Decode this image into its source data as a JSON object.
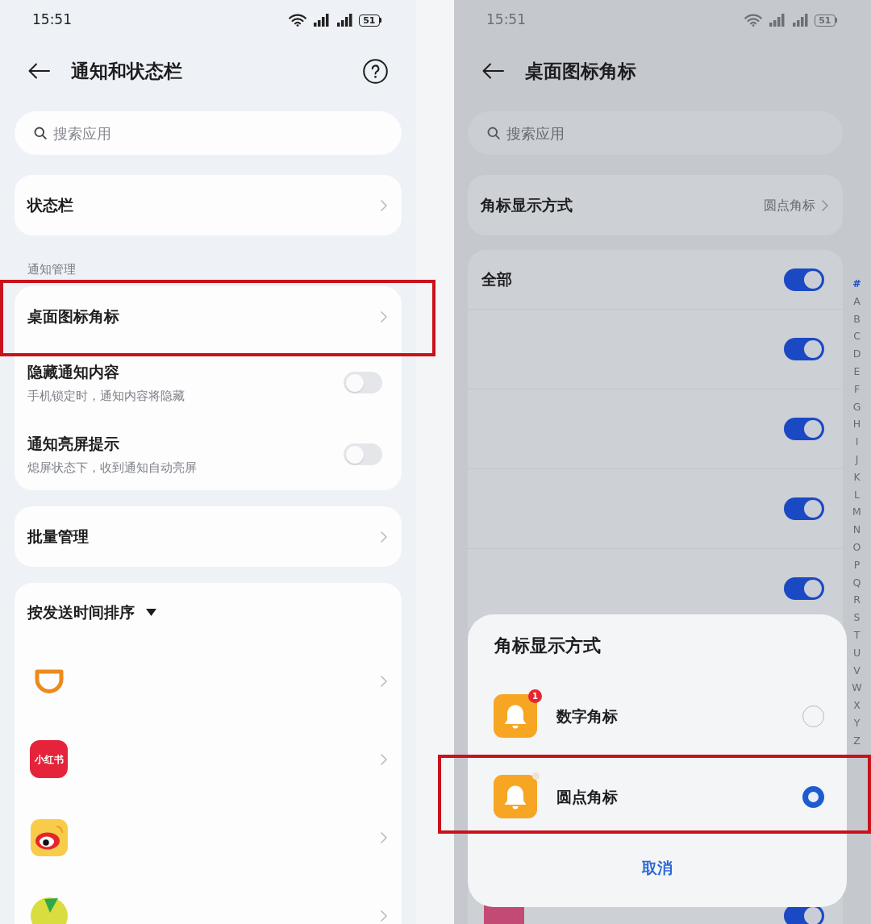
{
  "left_screen": {
    "status_bar": {
      "time": "15:51",
      "battery": "51"
    },
    "header": {
      "title": "通知和状态栏"
    },
    "search": {
      "placeholder": "搜索应用"
    },
    "groups": [
      {
        "items": [
          {
            "kind": "link",
            "label": "状态栏",
            "highlighted": false
          }
        ]
      },
      {
        "section_label": "通知管理",
        "items": [
          {
            "kind": "link",
            "label": "桌面图标角标",
            "highlighted": true
          },
          {
            "kind": "switch",
            "label": "隐藏通知内容",
            "description": "手机锁定时，通知内容将隐藏",
            "on": false,
            "highlighted": false
          },
          {
            "kind": "switch",
            "label": "通知亮屏提示",
            "description": "熄屏状态下，收到通知自动亮屏",
            "on": false,
            "highlighted": false
          }
        ]
      },
      {
        "items": [
          {
            "kind": "link",
            "label": "批量管理",
            "highlighted": false
          }
        ]
      }
    ],
    "app_list": {
      "sort_label": "按发送时间排序",
      "apps": [
        {
          "kind": "ring"
        },
        {
          "kind": "text_tile",
          "icon_text": "小红书"
        },
        {
          "kind": "eye_tile"
        },
        {
          "kind": "leaf"
        }
      ]
    }
  },
  "right_screen": {
    "status_bar": {
      "time": "15:51",
      "battery": "51"
    },
    "header": {
      "title": "桌面图标角标"
    },
    "search": {
      "placeholder": "搜索应用"
    },
    "display_mode": {
      "label": "角标显示方式",
      "value": "圆点角标"
    },
    "switch_rows": [
      {
        "label": "全部",
        "on": true
      },
      {
        "on": true
      },
      {
        "on": true
      },
      {
        "on": true
      },
      {
        "on": true
      }
    ],
    "bottom_row": {
      "on": true
    },
    "index_letters": [
      {
        "label": "#",
        "selected": true
      },
      {
        "label": "A",
        "selected": false
      },
      {
        "label": "B",
        "selected": false
      },
      {
        "label": "C",
        "selected": false
      },
      {
        "label": "D",
        "selected": false
      },
      {
        "label": "E",
        "selected": false
      },
      {
        "label": "F",
        "selected": false
      },
      {
        "label": "G",
        "selected": false
      },
      {
        "label": "H",
        "selected": false
      },
      {
        "label": "I",
        "selected": false
      },
      {
        "label": "J",
        "selected": false
      },
      {
        "label": "K",
        "selected": false
      },
      {
        "label": "L",
        "selected": false
      },
      {
        "label": "M",
        "selected": false
      },
      {
        "label": "N",
        "selected": false
      },
      {
        "label": "O",
        "selected": false
      },
      {
        "label": "P",
        "selected": false
      },
      {
        "label": "Q",
        "selected": false
      },
      {
        "label": "R",
        "selected": false
      },
      {
        "label": "S",
        "selected": false
      },
      {
        "label": "T",
        "selected": false
      },
      {
        "label": "U",
        "selected": false
      },
      {
        "label": "V",
        "selected": false
      },
      {
        "label": "W",
        "selected": false
      },
      {
        "label": "X",
        "selected": false
      },
      {
        "label": "Y",
        "selected": false
      },
      {
        "label": "Z",
        "selected": false
      }
    ],
    "sheet": {
      "title": "角标显示方式",
      "options": [
        {
          "kind": "number",
          "badge": "1",
          "label": "数字角标",
          "selected": false,
          "highlighted": false
        },
        {
          "kind": "dot",
          "label": "圆点角标",
          "selected": true,
          "highlighted": true
        }
      ],
      "cancel": "取消"
    }
  }
}
